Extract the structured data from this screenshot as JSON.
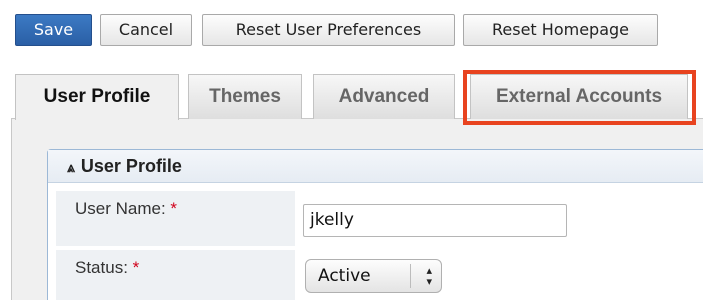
{
  "toolbar": {
    "save_label": "Save",
    "cancel_label": "Cancel",
    "reset_preferences_label": "Reset User Preferences",
    "reset_homepage_label": "Reset Homepage"
  },
  "tabs": [
    {
      "label": "User Profile",
      "active": true
    },
    {
      "label": "Themes",
      "active": false
    },
    {
      "label": "Advanced",
      "active": false
    },
    {
      "label": "External Accounts",
      "active": false,
      "highlighted": true
    }
  ],
  "section": {
    "title": "User Profile",
    "chevron_icon": "double-chevron-up-icon",
    "fields": [
      {
        "label": "User Name:",
        "required_marker": "*",
        "value": "jkelly"
      },
      {
        "label": "Status:",
        "required_marker": "*",
        "value": "Active"
      }
    ]
  },
  "colors": {
    "primary_button": "#2f6db5",
    "highlight_border": "#e8431f",
    "required": "#d0021b",
    "section_border": "#9cb8d6"
  }
}
